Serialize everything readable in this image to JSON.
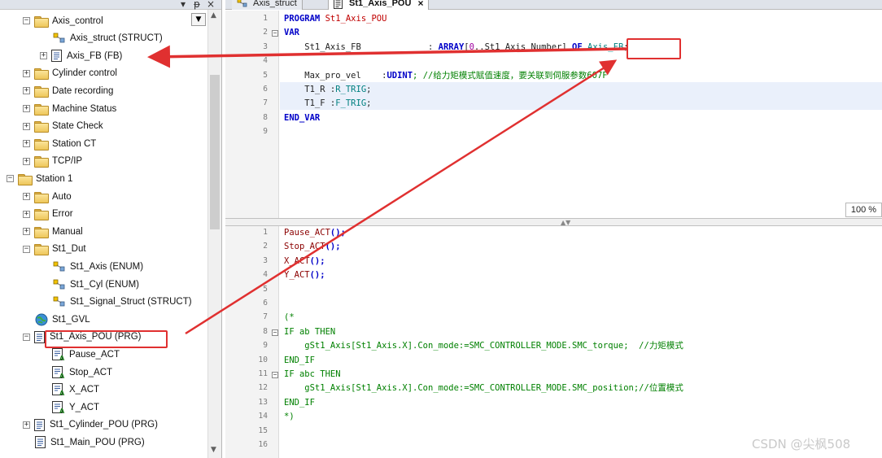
{
  "tree": {
    "items": [
      {
        "label": "Axis_control",
        "icon": "folder-icon",
        "expander": "−"
      },
      {
        "label": "Axis_struct (STRUCT)",
        "icon": "dut-icon",
        "expander": ""
      },
      {
        "label": "Axis_FB (FB)",
        "icon": "function-block-icon",
        "expander": "+"
      },
      {
        "label": "Cylinder control",
        "icon": "folder-icon",
        "expander": "+"
      },
      {
        "label": "Date  recording",
        "icon": "folder-icon",
        "expander": "+"
      },
      {
        "label": "Machine Status",
        "icon": "folder-icon",
        "expander": "+"
      },
      {
        "label": "State Check",
        "icon": "folder-icon",
        "expander": "+"
      },
      {
        "label": "Station CT",
        "icon": "folder-icon",
        "expander": "+"
      },
      {
        "label": "TCP/IP",
        "icon": "folder-icon",
        "expander": "+"
      },
      {
        "label": "Station 1",
        "icon": "folder-icon",
        "expander": "−"
      },
      {
        "label": "Auto",
        "icon": "folder-icon",
        "expander": "+"
      },
      {
        "label": "Error",
        "icon": "folder-icon",
        "expander": "+"
      },
      {
        "label": "Manual",
        "icon": "folder-icon",
        "expander": "+"
      },
      {
        "label": "St1_Dut",
        "icon": "folder-icon",
        "expander": "−"
      },
      {
        "label": "St1_Axis (ENUM)",
        "icon": "dut-icon",
        "expander": ""
      },
      {
        "label": "St1_Cyl (ENUM)",
        "icon": "dut-icon",
        "expander": ""
      },
      {
        "label": "St1_Signal_Struct (STRUCT)",
        "icon": "dut-icon",
        "expander": ""
      },
      {
        "label": "St1_GVL",
        "icon": "globe-icon",
        "expander": ""
      },
      {
        "label": "St1_Axis_POU (PRG)",
        "icon": "program-icon",
        "expander": "−"
      },
      {
        "label": "Pause_ACT",
        "icon": "action-icon",
        "expander": ""
      },
      {
        "label": "Stop_ACT",
        "icon": "action-icon",
        "expander": ""
      },
      {
        "label": "X_ACT",
        "icon": "action-icon",
        "expander": ""
      },
      {
        "label": "Y_ACT",
        "icon": "action-icon",
        "expander": ""
      },
      {
        "label": "St1_Cylinder_POU (PRG)",
        "icon": "program-icon",
        "expander": "+"
      },
      {
        "label": "St1_Main_POU (PRG)",
        "icon": "program-icon",
        "expander": ""
      }
    ]
  },
  "tabs": [
    {
      "label": "Axis_struct",
      "active": false
    },
    {
      "label": "St1_Axis_POU",
      "active": true,
      "close": "×"
    }
  ],
  "pane_buttons": {
    "dropdown": "▾",
    "pin": "ᵽ",
    "close": "×"
  },
  "zoom": "100 %",
  "declaration": {
    "line_numbers": [
      "1",
      "2",
      "3",
      "4",
      "5",
      "6",
      "7",
      "8",
      "9"
    ],
    "fold_markers": {
      "2": "−"
    },
    "lines": [
      [
        {
          "t": "PROGRAM ",
          "c": "kw"
        },
        {
          "t": "St1_Axis_POU",
          "c": "pou"
        }
      ],
      [
        {
          "t": "VAR",
          "c": "kw"
        }
      ],
      [
        {
          "t": "    St1_Axis_FB             : ",
          "c": "id"
        },
        {
          "t": "ARRAY",
          "c": "kw"
        },
        {
          "t": "[",
          "c": "id"
        },
        {
          "t": "0",
          "c": "num"
        },
        {
          "t": "..St1 Axis Number] ",
          "c": "id"
        },
        {
          "t": "OF",
          "c": "kw"
        },
        {
          "t": " Axis_FB",
          "c": "tp"
        },
        {
          "t": ";",
          "c": "id"
        }
      ],
      [],
      [
        {
          "t": "    Max_pro_vel    :",
          "c": "id"
        },
        {
          "t": "UDINT",
          "c": "kw"
        },
        {
          "t": "; //给力矩模式赋值速度，要关联到伺服参数607F",
          "c": "cm"
        }
      ],
      [
        {
          "t": "    T1_R :",
          "c": "id"
        },
        {
          "t": "R_TRIG",
          "c": "tp"
        },
        {
          "t": ";",
          "c": "id"
        }
      ],
      [
        {
          "t": "    T1_F :",
          "c": "id"
        },
        {
          "t": "F_TRIG",
          "c": "tp"
        },
        {
          "t": ";",
          "c": "id"
        }
      ],
      [
        {
          "t": "END_VAR",
          "c": "kw"
        }
      ],
      []
    ]
  },
  "implementation": {
    "line_numbers": [
      "1",
      "2",
      "3",
      "4",
      "5",
      "6",
      "7",
      "8",
      "9",
      "10",
      "11",
      "12",
      "13",
      "14",
      "15",
      "16"
    ],
    "fold_markers": {
      "8": "−",
      "11": "−"
    },
    "lines": [
      [
        {
          "t": "Pause_ACT",
          "c": "act"
        },
        {
          "t": "();",
          "c": "kw"
        }
      ],
      [
        {
          "t": "Stop_ACT",
          "c": "act"
        },
        {
          "t": "();",
          "c": "kw"
        }
      ],
      [
        {
          "t": "X_ACT",
          "c": "act"
        },
        {
          "t": "();",
          "c": "kw"
        }
      ],
      [
        {
          "t": "Y_ACT",
          "c": "act"
        },
        {
          "t": "();",
          "c": "kw"
        }
      ],
      [],
      [],
      [
        {
          "t": "(*",
          "c": "cm"
        }
      ],
      [
        {
          "t": "IF ab THEN",
          "c": "cm"
        }
      ],
      [
        {
          "t": "    gSt1_Axis[St1_Axis.X].Con_mode:=SMC_CONTROLLER_MODE.SMC_torque;  //力矩模式",
          "c": "cm"
        }
      ],
      [
        {
          "t": "END_IF",
          "c": "cm"
        }
      ],
      [
        {
          "t": "IF abc THEN",
          "c": "cm"
        }
      ],
      [
        {
          "t": "    gSt1_Axis[St1_Axis.X].Con_mode:=SMC_CONTROLLER_MODE.SMC_position;//位置模式",
          "c": "cm"
        }
      ],
      [
        {
          "t": "END_IF",
          "c": "cm"
        }
      ],
      [
        {
          "t": "*)",
          "c": "cm"
        }
      ],
      [],
      []
    ]
  },
  "watermark": "CSDN @尖枫508",
  "colors": {
    "annotation_red": "#e03030",
    "keyword": "#0000c8",
    "comment": "#008000",
    "type": "#008080"
  }
}
